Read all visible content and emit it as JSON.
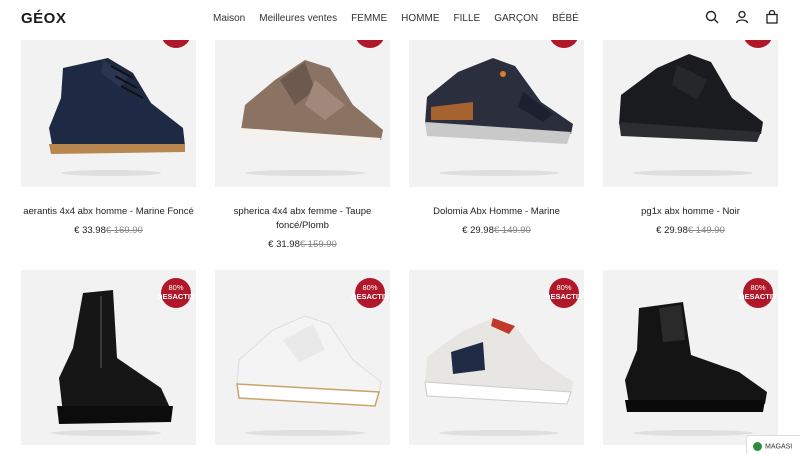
{
  "header": {
    "logo": "GÉOX",
    "nav": [
      "Maison",
      "Meilleures ventes",
      "FEMME",
      "HOMME",
      "FILLE",
      "GARÇON",
      "BÉBÉ"
    ]
  },
  "badge": {
    "pct": "80%",
    "label": "DESACTIV"
  },
  "products_row1": [
    {
      "name": "aerantis 4x4 abx homme - Marine Foncé",
      "price": "€ 33.98",
      "old": "€ 169.90"
    },
    {
      "name": "spherica 4x4 abx femme - Taupe foncé/Plomb",
      "price": "€ 31.98",
      "old": "€ 159.90"
    },
    {
      "name": "Dolomia Abx Homme - Marine",
      "price": "€ 29.98",
      "old": "€ 149.90"
    },
    {
      "name": "pg1x abx homme - Noir",
      "price": "€ 29.98",
      "old": "€ 149.90"
    }
  ],
  "store_label": "MAGASI",
  "colors": {
    "accent": "#b0182a",
    "thumb_bg": "#f2f2f2",
    "store_green": "#2e8b3d"
  }
}
